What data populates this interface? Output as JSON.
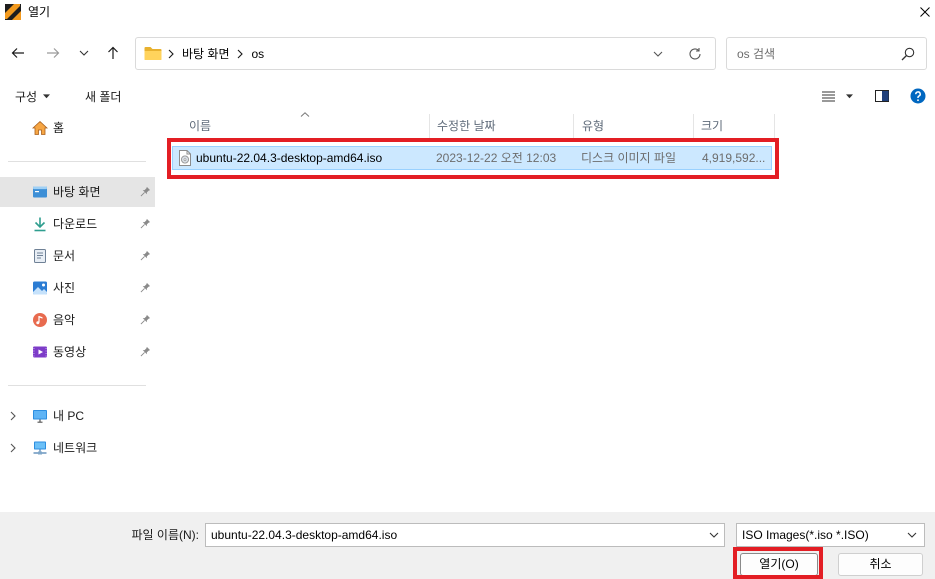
{
  "window": {
    "title": "열기"
  },
  "navigation": {
    "back_enabled": true,
    "forward_enabled": false,
    "breadcrumb": [
      "바탕 화면",
      "os"
    ],
    "search_placeholder": "os 검색"
  },
  "toolbar": {
    "organize_label": "구성",
    "new_folder_label": "새 폴더",
    "view_icon": "list-view-icon",
    "preview_pane_icon": "preview-pane-icon",
    "help_icon": "help-icon"
  },
  "sidebar": {
    "home": {
      "label": "홈",
      "icon": "home-icon"
    },
    "pinned": [
      {
        "label": "바탕 화면",
        "icon": "desktop-icon",
        "selected": true
      },
      {
        "label": "다운로드",
        "icon": "download-icon"
      },
      {
        "label": "문서",
        "icon": "documents-icon"
      },
      {
        "label": "사진",
        "icon": "pictures-icon"
      },
      {
        "label": "음악",
        "icon": "music-icon"
      },
      {
        "label": "동영상",
        "icon": "videos-icon"
      }
    ],
    "locations": [
      {
        "label": "내 PC",
        "icon": "pc-icon",
        "expandable": true
      },
      {
        "label": "네트워크",
        "icon": "network-icon",
        "expandable": true
      }
    ]
  },
  "file_list": {
    "columns": [
      "이름",
      "수정한 날짜",
      "유형",
      "크기"
    ],
    "sorted_ascending_by_first_column": true,
    "rows": [
      {
        "name": "ubuntu-22.04.3-desktop-amd64.iso",
        "modified": "2023-12-22 오전 12:03",
        "type": "디스크 이미지 파일",
        "size": "4,919,592...",
        "icon": "disc-image-file-icon",
        "selected": true
      }
    ]
  },
  "footer": {
    "filename_label": "파일 이름(N):",
    "filename_value": "ubuntu-22.04.3-desktop-amd64.iso",
    "filetype_value": "ISO Images(*.iso *.ISO)",
    "open_label": "열기(O)",
    "cancel_label": "취소"
  },
  "colors": {
    "selection_bg": "#cce8ff",
    "selection_border": "#99d1ff",
    "nav_selected_bg": "#e5e5e5",
    "footer_bg": "#f0f0f0",
    "help_blue": "#0067c0",
    "annotation_red": "#e31e24"
  }
}
